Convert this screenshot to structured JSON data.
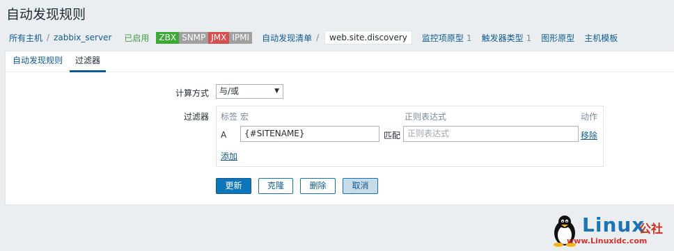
{
  "page": {
    "title": "自动发现规则"
  },
  "breadcrumbs": {
    "all_hosts": "所有主机",
    "separator": "/",
    "host": "zabbix_server",
    "status": "已启用",
    "badges": [
      "ZBX",
      "SNMP",
      "JMX",
      "IPMI"
    ],
    "discovery_list": "自动发现清单",
    "current_rule": "web.site.discovery",
    "item_prototypes": {
      "label": "监控项原型",
      "count": "1"
    },
    "trigger_prototypes": {
      "label": "触发器类型",
      "count": "1"
    },
    "graph_prototypes": "图形原型",
    "host_prototypes": "主机模板"
  },
  "tabs": [
    {
      "label": "自动发现规则",
      "active": false
    },
    {
      "label": "过滤器",
      "active": true
    }
  ],
  "form": {
    "calc_label": "计算方式",
    "calc_value": "与/或",
    "filters_label": "过滤器",
    "columns": {
      "label": "标签",
      "macro": "宏",
      "regex": "正则表达式",
      "action": "动作"
    },
    "rows": [
      {
        "label": "A",
        "macro": "{#SITENAME}",
        "operator": "匹配",
        "regex_placeholder": "正则表达式",
        "action": "移除"
      }
    ],
    "add_link": "添加"
  },
  "buttons": {
    "update": "更新",
    "clone": "克隆",
    "delete": "删除",
    "cancel": "取消"
  },
  "watermark": {
    "brand": "Linux",
    "cn": "公社",
    "url": "www.Linuxidc.com"
  },
  "colors": {
    "accent": "#0d75b8",
    "link": "#0d5b93",
    "enabled": "#429e47"
  }
}
